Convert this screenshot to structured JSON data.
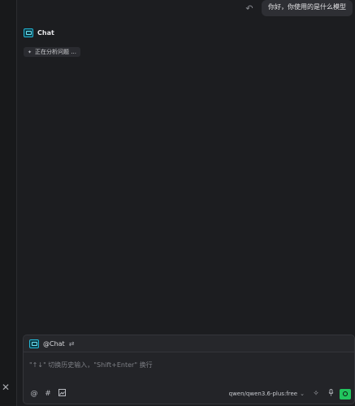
{
  "sidebar": {
    "close_icon": "close-icon"
  },
  "conversation": {
    "user_message": "你好，你使用的是什么模型",
    "assistant_name": "Chat",
    "thinking_label": "正在分析问题 ..."
  },
  "composer": {
    "mention": "@Chat",
    "placeholder": "\"↑↓\" 切换历史输入，\"Shift+Enter\" 换行",
    "model": "qwen/qwen3.6-plus:free",
    "icons": [
      "at-icon",
      "hash-icon",
      "image-icon",
      "sparkle-icon",
      "mic-icon",
      "send-icon"
    ]
  },
  "colors": {
    "send": "#22c55e",
    "logo": "#22b8d8",
    "background": "#1c1d20"
  }
}
